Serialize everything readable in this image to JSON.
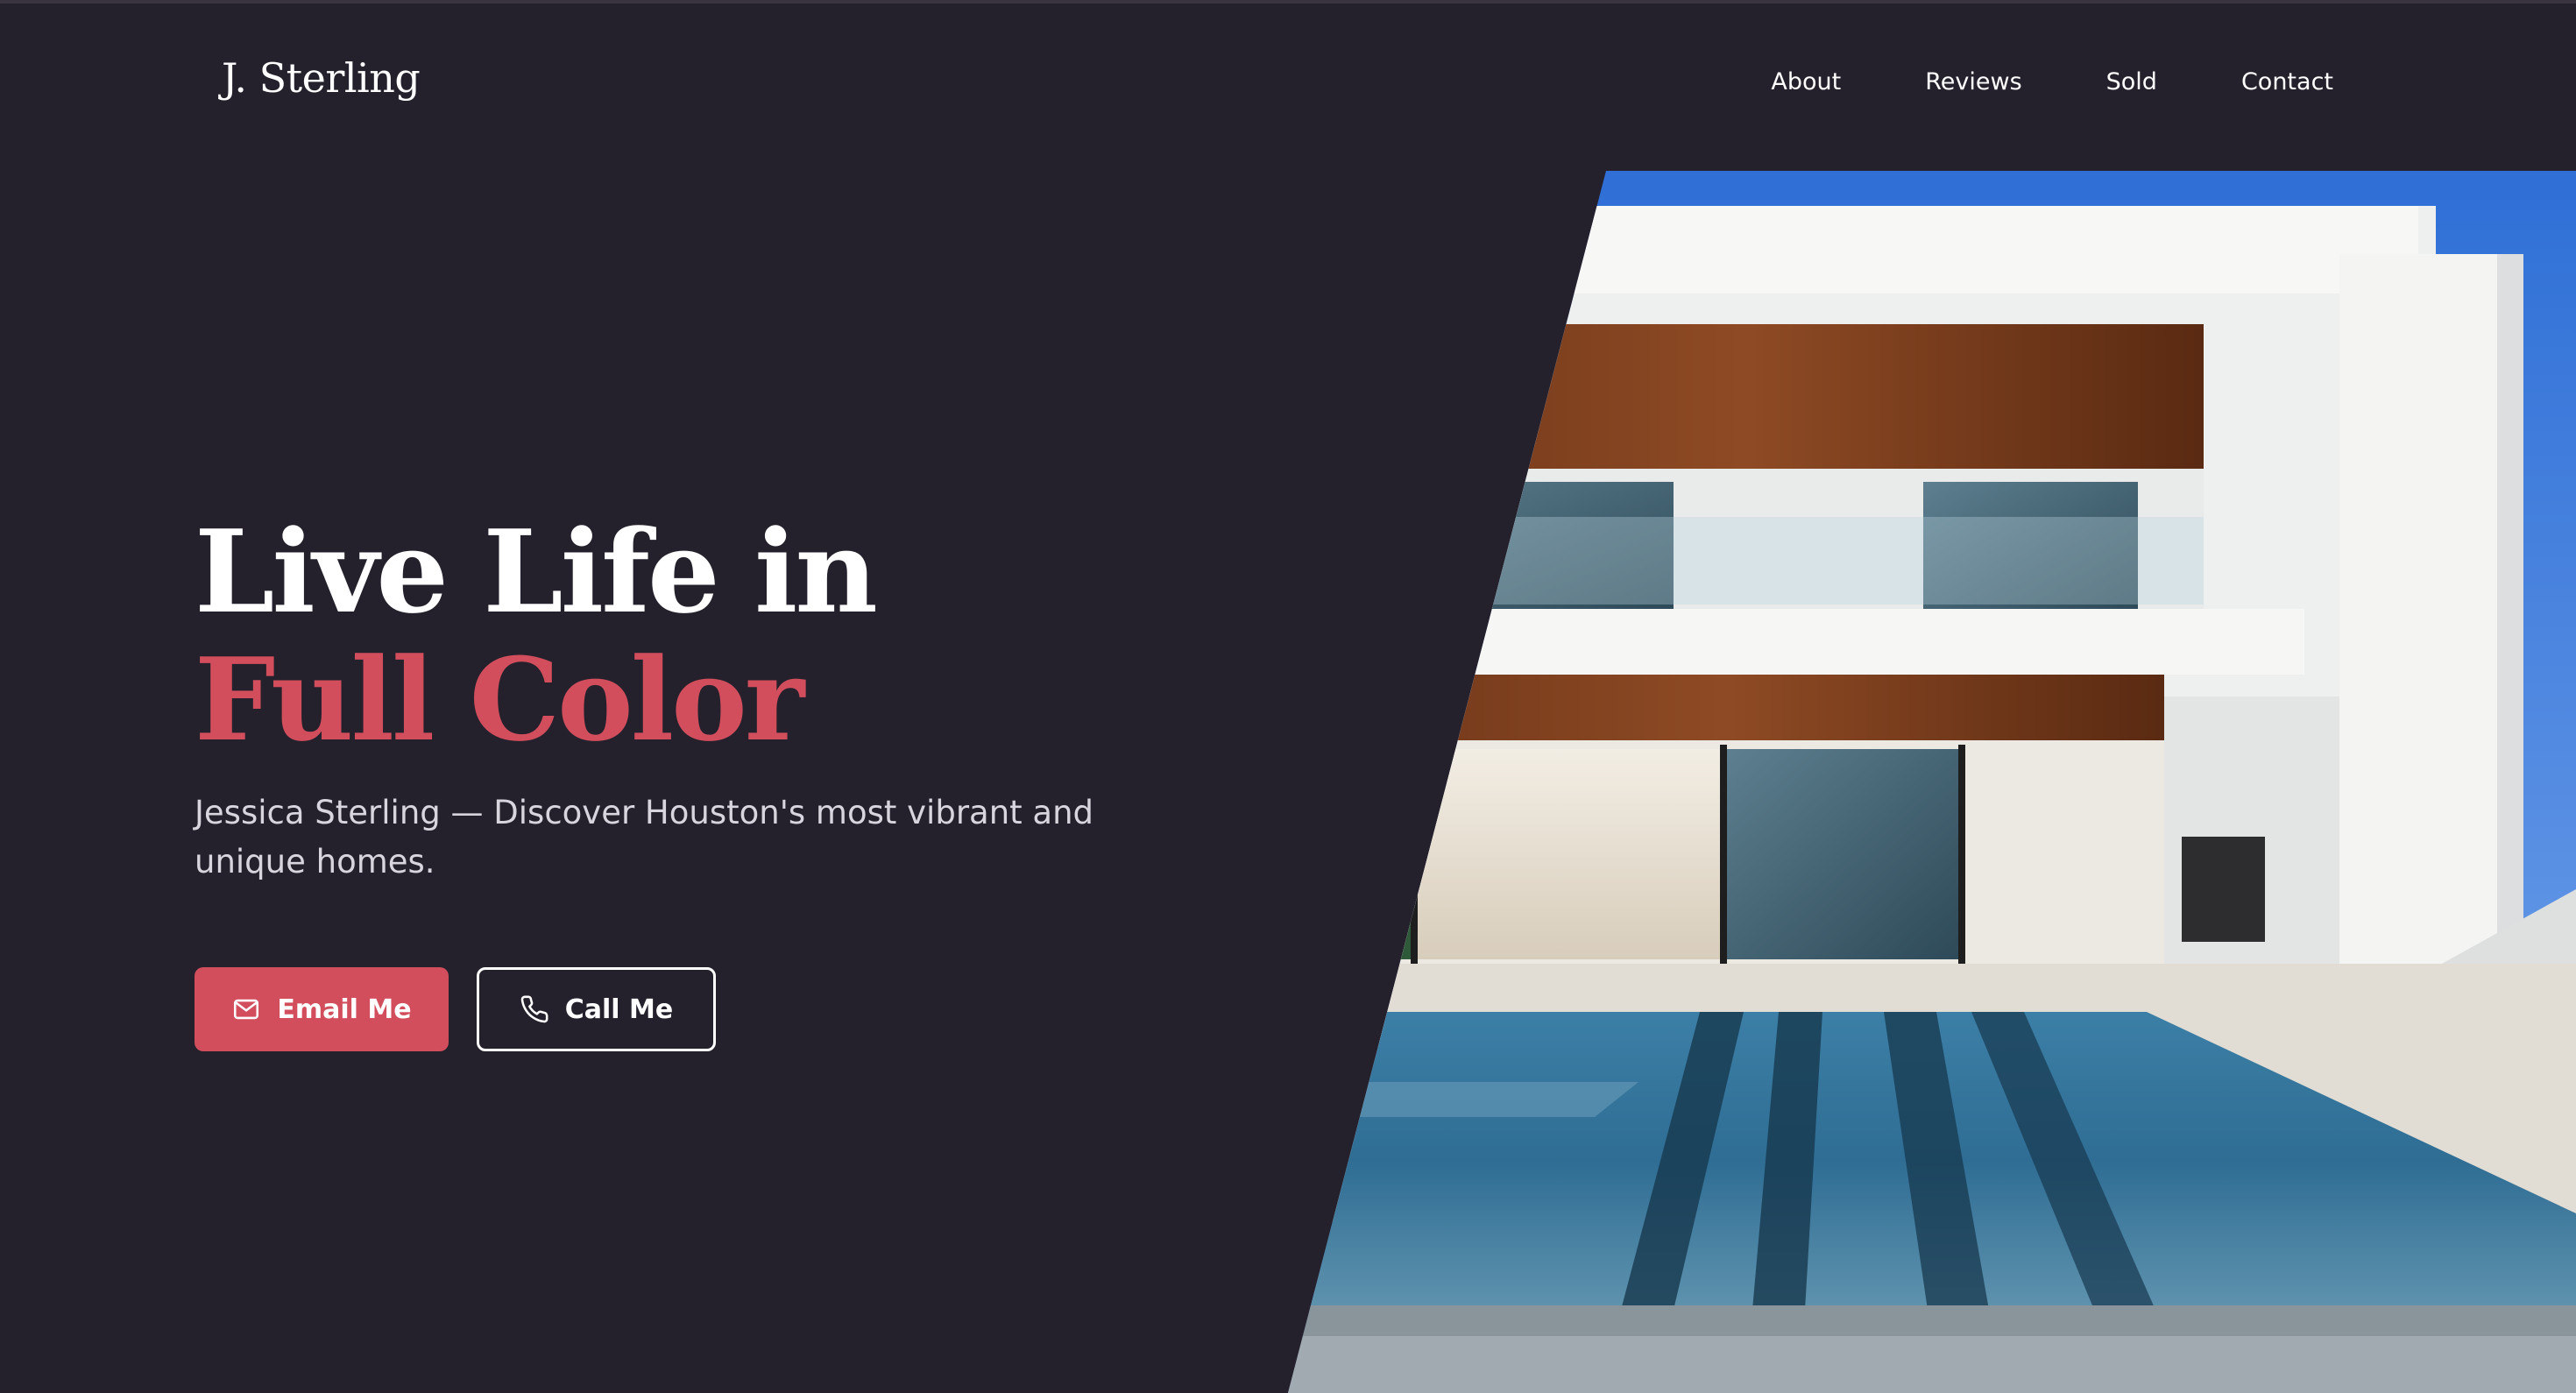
{
  "brand": {
    "logo": "J. Sterling"
  },
  "nav": {
    "items": [
      {
        "label": "About"
      },
      {
        "label": "Reviews"
      },
      {
        "label": "Sold"
      },
      {
        "label": "Contact"
      }
    ]
  },
  "hero": {
    "title_line1": "Live Life in",
    "title_line2": "Full Color",
    "subtitle": "Jessica Sterling — Discover Houston's most vibrant and unique homes.",
    "email_button": {
      "label": "Email Me",
      "icon": "mail-icon"
    },
    "call_button": {
      "label": "Call Me",
      "icon": "phone-icon"
    },
    "image": {
      "icon": "modern-house-pool-photo"
    }
  },
  "colors": {
    "background": "#25212c",
    "accent": "#d24e5d",
    "text": "#ffffff",
    "subtext": "#d9d5de"
  }
}
